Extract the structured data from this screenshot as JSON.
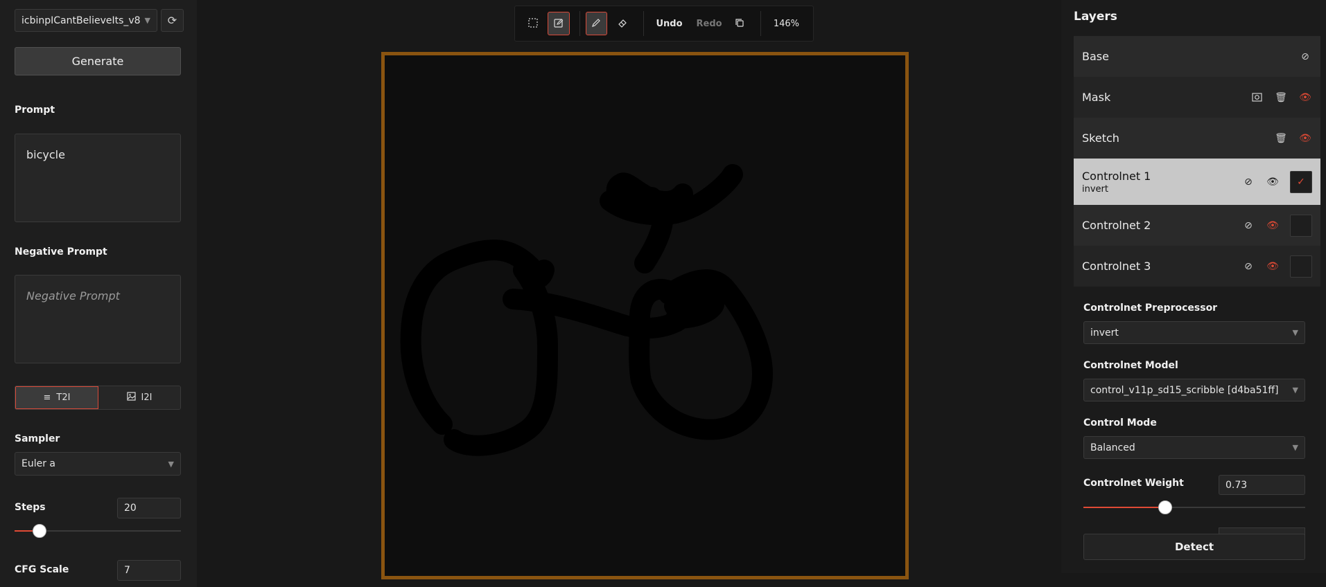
{
  "left_panel": {
    "model_select": "icbinpICantBelieveIts_v8",
    "generate_label": "Generate",
    "prompt_label": "Prompt",
    "prompt_value": "bicycle",
    "negative_label": "Negative Prompt",
    "negative_placeholder": "Negative Prompt",
    "modes": [
      {
        "label": "T2I",
        "icon": "lines-icon",
        "active": true
      },
      {
        "label": "I2I",
        "icon": "image-icon",
        "active": false
      }
    ],
    "sampler_label": "Sampler",
    "sampler_value": "Euler a",
    "steps_label": "Steps",
    "steps_value": "20",
    "steps_fraction": 0.15,
    "cfg_label": "CFG Scale",
    "cfg_value": "7"
  },
  "toolbar": {
    "undo_label": "Undo",
    "redo_label": "Redo",
    "zoom": "146%"
  },
  "layers_panel": {
    "title": "Layers",
    "layers": [
      {
        "name": "Base",
        "sub": ""
      },
      {
        "name": "Mask",
        "sub": ""
      },
      {
        "name": "Sketch",
        "sub": ""
      },
      {
        "name": "Controlnet 1",
        "sub": "invert"
      },
      {
        "name": "Controlnet 2",
        "sub": ""
      },
      {
        "name": "Controlnet 3",
        "sub": ""
      }
    ],
    "preprocessor_label": "Controlnet Preprocessor",
    "preprocessor_value": "invert",
    "model_label": "Controlnet Model",
    "model_value": "control_v11p_sd15_scribble [d4ba51ff]",
    "mode_label": "Control Mode",
    "mode_value": "Balanced",
    "weight_label": "Controlnet Weight",
    "weight_value": "0.73",
    "weight_fraction": 0.37,
    "detect_label": "Detect"
  },
  "colors": {
    "accent": "#e04a35",
    "canvas_border": "#8a5410"
  }
}
